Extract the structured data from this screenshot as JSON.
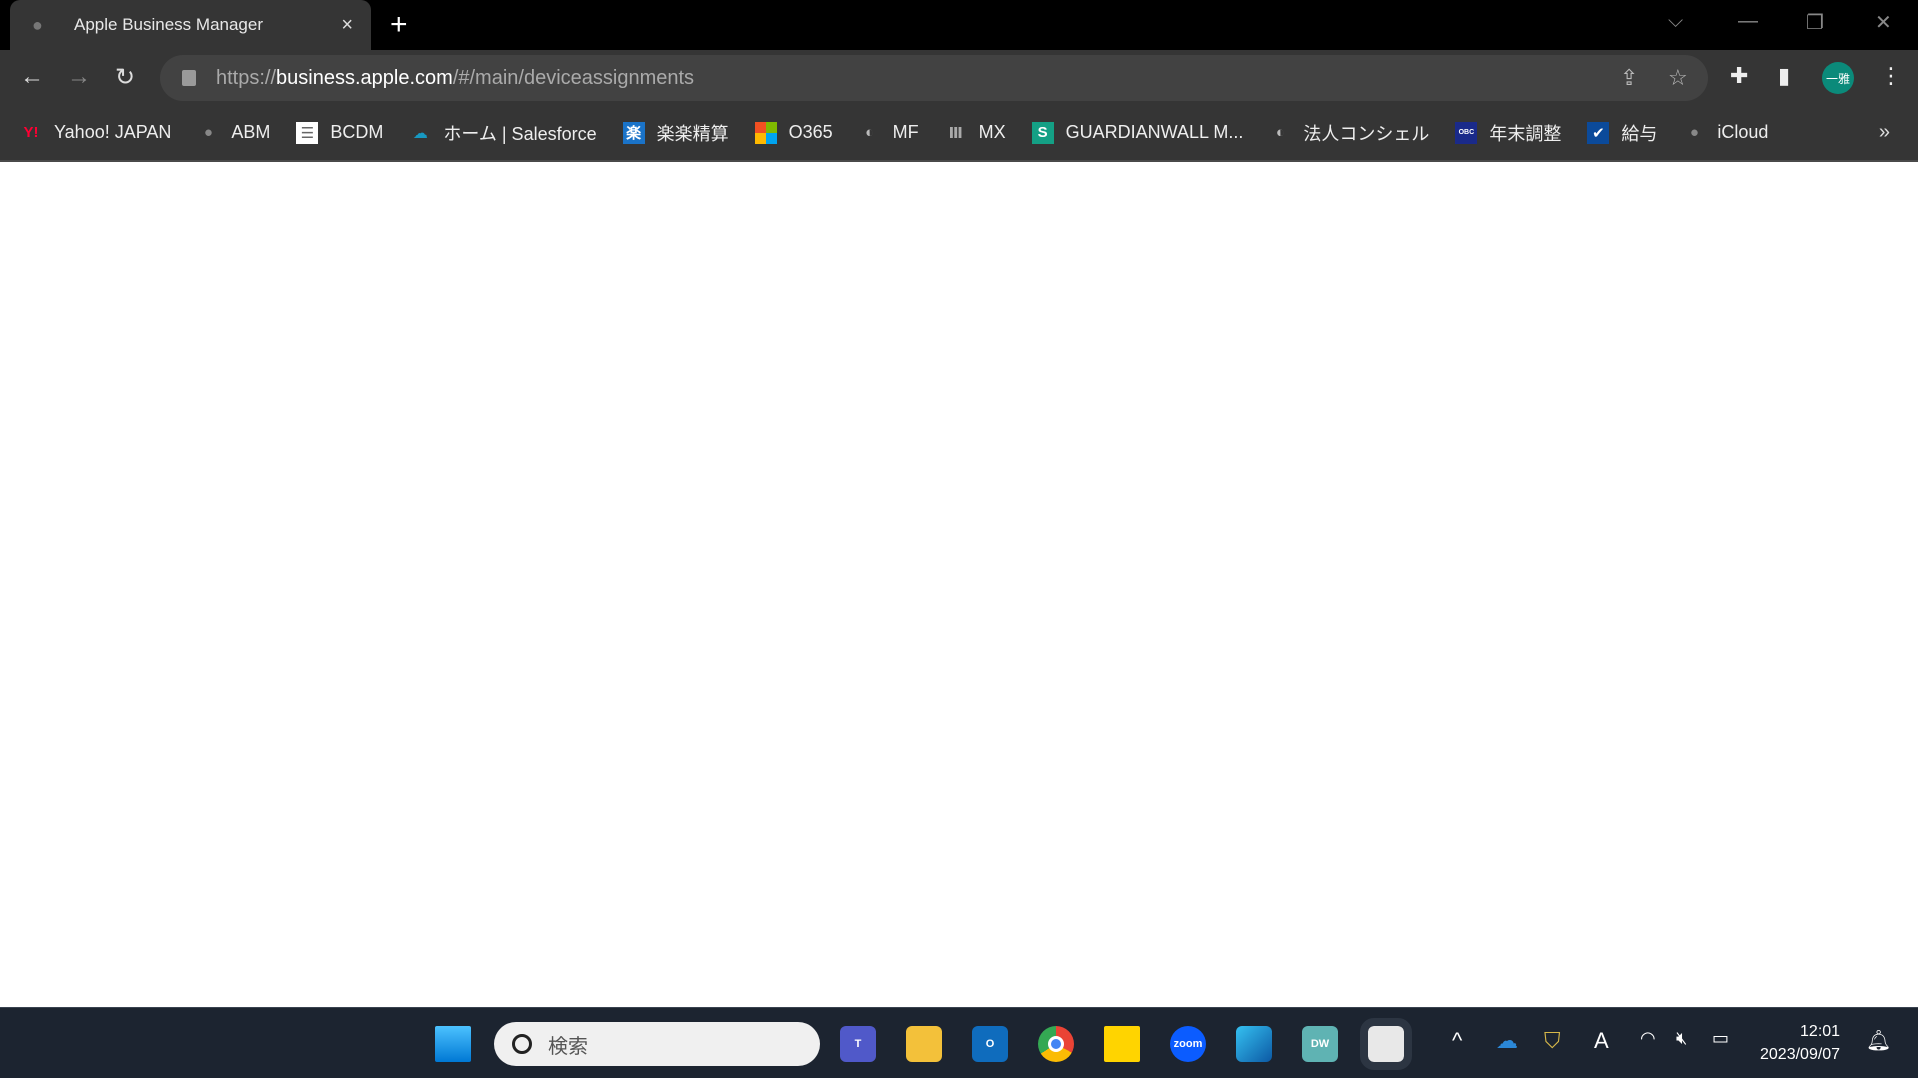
{
  "tab": {
    "title": "Apple Business Manager",
    "favicon": "apple-icon",
    "close": "×",
    "new_tab": "+"
  },
  "address": {
    "scheme": "https://",
    "host": "business.apple.com",
    "path": "/#/main/deviceassignments"
  },
  "profile": {
    "initials": "一雅",
    "color": "#0b8a7a"
  },
  "bookmarks": [
    {
      "label": "Yahoo! JAPAN",
      "icon": "yahoo-icon",
      "glyph": "Y!",
      "color": "#ff0033",
      "bg": "transparent"
    },
    {
      "label": "ABM",
      "icon": "apple-icon",
      "glyph": "",
      "color": "#888",
      "bg": "transparent"
    },
    {
      "label": "BCDM",
      "icon": "document-icon",
      "glyph": "☰",
      "color": "#666",
      "bg": "#fff"
    },
    {
      "label": "ホーム | Salesforce",
      "icon": "salesforce-cloud-icon",
      "glyph": "☁",
      "color": "#1798c1",
      "bg": "transparent"
    },
    {
      "label": "楽楽精算",
      "icon": "rakuraku-icon",
      "glyph": "楽",
      "color": "#fff",
      "bg": "#1a73c8"
    },
    {
      "label": "O365",
      "icon": "microsoft-icon",
      "glyph": "",
      "color": "",
      "bg": "ms"
    },
    {
      "label": "MF",
      "icon": "globe-icon",
      "glyph": "◐",
      "color": "#bbb",
      "bg": "transparent"
    },
    {
      "label": "MX",
      "icon": "mx-icon",
      "glyph": "Ⅲ",
      "color": "#aaa",
      "bg": "transparent"
    },
    {
      "label": "GUARDIANWALL M...",
      "icon": "guardianwall-icon",
      "glyph": "S",
      "color": "#fff",
      "bg": "#14a085"
    },
    {
      "label": "法人コンシェル",
      "icon": "globe-icon",
      "glyph": "◐",
      "color": "#bbb",
      "bg": "transparent"
    },
    {
      "label": "年末調整",
      "icon": "obc-icon",
      "glyph": "OBC",
      "color": "#fff",
      "bg": "#1a2a8a"
    },
    {
      "label": "給与",
      "icon": "payroll-icon",
      "glyph": "✔",
      "color": "#fff",
      "bg": "#0b4a9a"
    },
    {
      "label": "iCloud",
      "icon": "apple-icon",
      "glyph": "",
      "color": "#888",
      "bg": "transparent"
    }
  ],
  "taskbar": {
    "search_placeholder": "検索",
    "zoom_label": "zoom",
    "dw_label": "DW",
    "time": "12:01",
    "date": "2023/09/07"
  }
}
